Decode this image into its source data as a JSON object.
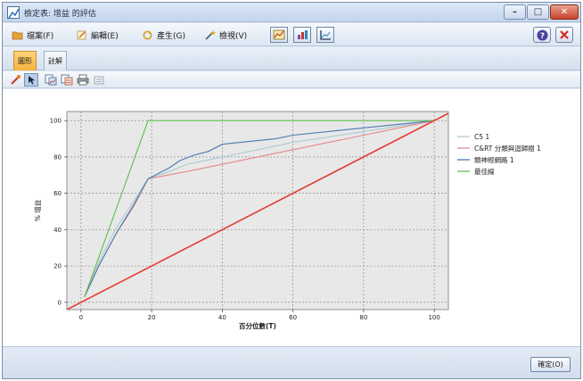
{
  "window": {
    "title": "檢定表: 增益 的評估"
  },
  "menu": {
    "file": "檔案(F)",
    "edit": "編輯(E)",
    "generate": "產生(G)",
    "view": "檢視(V)"
  },
  "tabs": {
    "graph": "圖形",
    "annotations": "註解"
  },
  "icons": {
    "file": "folder-icon",
    "edit": "pencil-icon",
    "generate": "refresh-icon",
    "view": "magic-wand-icon",
    "help": "help-icon",
    "close": "close-icon"
  },
  "colors": {
    "accent": "#f4b43d",
    "close": "#c8432a",
    "plot_bg": "#e8e8e8"
  },
  "chart_data": {
    "type": "line",
    "title": "",
    "xlabel": "百分位數(T)",
    "ylabel": "% 增益",
    "xlim": [
      -4,
      104
    ],
    "ylim": [
      -4,
      105
    ],
    "xticks": [
      0,
      20,
      40,
      60,
      80,
      100
    ],
    "yticks": [
      0,
      20,
      40,
      60,
      80,
      100
    ],
    "grid": true,
    "legend_position": "right",
    "series": [
      {
        "name": "C5 1",
        "color": "#a9cbd3",
        "x": [
          1,
          5,
          10,
          15,
          19,
          25,
          30,
          40,
          50,
          60,
          70,
          80,
          90,
          100
        ],
        "y": [
          3,
          22,
          41,
          56,
          68,
          72,
          76,
          80,
          84,
          88,
          91,
          94,
          97,
          100
        ]
      },
      {
        "name": "C&RT 分類與迴歸樹 1",
        "color": "#e4888b",
        "x": [
          1,
          5,
          10,
          15,
          19,
          30,
          40,
          50,
          60,
          70,
          80,
          90,
          100
        ],
        "y": [
          3,
          20,
          38,
          53,
          68,
          72,
          76,
          80,
          84,
          88,
          92,
          96,
          100
        ]
      },
      {
        "name": "類神經網路 1",
        "color": "#4a7ab3",
        "x": [
          1,
          5,
          10,
          15,
          19,
          22,
          25,
          28,
          32,
          36,
          40,
          45,
          50,
          55,
          60,
          70,
          80,
          90,
          100
        ],
        "y": [
          3,
          20,
          38,
          54,
          68,
          71,
          74,
          78,
          81,
          83,
          87,
          88,
          89,
          90,
          92,
          94,
          96,
          98,
          100
        ]
      },
      {
        "name": "最佳線",
        "color": "#5cbf4e",
        "x": [
          1,
          19,
          100
        ],
        "y": [
          3,
          100,
          100
        ]
      },
      {
        "name": "",
        "color": "#e63b2e",
        "x": [
          -4,
          104
        ],
        "y": [
          -4,
          104
        ]
      }
    ]
  },
  "footer": {
    "ok_label": "確定(O)"
  }
}
